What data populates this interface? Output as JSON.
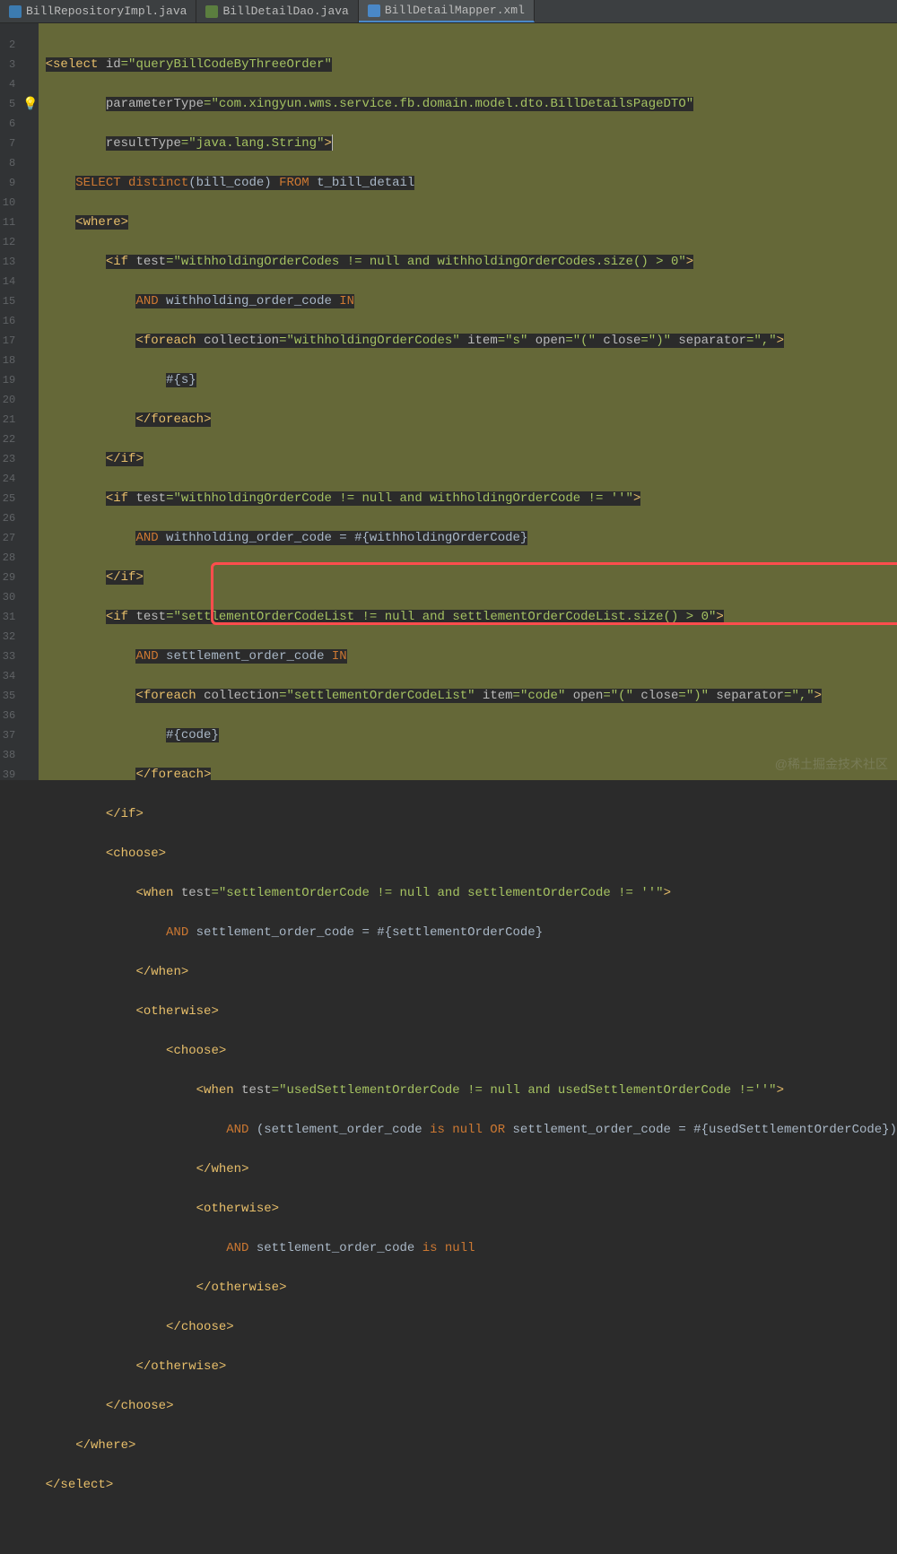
{
  "tabs": [
    {
      "label": "BillRepositoryImpl.java"
    },
    {
      "label": "BillDetailDao.java"
    },
    {
      "label": "BillDetailMapper.xml"
    }
  ],
  "gutter": {
    "start": 2
  },
  "code": {
    "l1a": "<",
    "l1b": "select ",
    "l1c": "id",
    "l1d": "=",
    "l1e": "\"queryBillCodeByThreeOrder\"",
    "l2a": "parameterType",
    "l2b": "=",
    "l2c": "\"com.xingyun.wms.service.fb.domain.model.dto.BillDetailsPageDTO\"",
    "l3a": "resultType",
    "l3b": "=",
    "l3c": "\"java.lang.String\"",
    "l3d": ">",
    "l4a": "SELECT ",
    "l4b": "distinct",
    "l4c": "(",
    "l4d": "bill_code",
    "l4e": ") ",
    "l4f": "FROM ",
    "l4g": "t_bill_detail",
    "l5a": "<",
    "l5b": "where",
    "l5c": ">",
    "l6a": "<",
    "l6b": "if ",
    "l6c": "test",
    "l6d": "=",
    "l6e": "\"withholdingOrderCodes != null and withholdingOrderCodes.size() > 0\"",
    "l6f": ">",
    "l7a": "AND ",
    "l7b": "withholding_order_code ",
    "l7c": "IN",
    "l8a": "<",
    "l8b": "foreach ",
    "l8c": "collection",
    "l8d": "=",
    "l8e": "\"withholdingOrderCodes\" ",
    "l8f": "item",
    "l8g": "=",
    "l8h": "\"s\" ",
    "l8i": "open",
    "l8j": "=",
    "l8k": "\"(\" ",
    "l8l": "close",
    "l8m": "=",
    "l8n": "\")\" ",
    "l8o": "separator",
    "l8p": "=",
    "l8q": "\",\"",
    "l8r": ">",
    "l9a": "#{s}",
    "l10a": "</",
    "l10b": "foreach",
    "l10c": ">",
    "l11a": "</",
    "l11b": "if",
    "l11c": ">",
    "l12a": "<",
    "l12b": "if ",
    "l12c": "test",
    "l12d": "=",
    "l12e": "\"withholdingOrderCode != null and withholdingOrderCode != ''\"",
    "l12f": ">",
    "l13a": "AND ",
    "l13b": "withholding_order_code = #{withholdingOrderCode}",
    "l14a": "</",
    "l14b": "if",
    "l14c": ">",
    "l15a": "<",
    "l15b": "if ",
    "l15c": "test",
    "l15d": "=",
    "l15e": "\"settlementOrderCodeList != null and settlementOrderCodeList.size() > 0\"",
    "l15f": ">",
    "l16a": "AND ",
    "l16b": "settlement_order_code ",
    "l16c": "IN",
    "l17a": "<",
    "l17b": "foreach ",
    "l17c": "collection",
    "l17d": "=",
    "l17e": "\"settlementOrderCodeList\" ",
    "l17f": "item",
    "l17g": "=",
    "l17h": "\"code\" ",
    "l17i": "open",
    "l17j": "=",
    "l17k": "\"(\" ",
    "l17l": "close",
    "l17m": "=",
    "l17n": "\")\" ",
    "l17o": "separator",
    "l17p": "=",
    "l17q": "\",\"",
    "l17r": ">",
    "l18a": "#{code}",
    "l19a": "</",
    "l19b": "foreach",
    "l19c": ">",
    "l20a": "</",
    "l20b": "if",
    "l20c": ">",
    "l21a": "<",
    "l21b": "choose",
    "l21c": ">",
    "l22a": "<",
    "l22b": "when ",
    "l22c": "test",
    "l22d": "=",
    "l22e": "\"settlementOrderCode != null and settlementOrderCode != ''\"",
    "l22f": ">",
    "l23a": "AND ",
    "l23b": "settlement_order_code = #{settlementOrderCode}",
    "l24a": "</",
    "l24b": "when",
    "l24c": ">",
    "l25a": "<",
    "l25b": "otherwise",
    "l25c": ">",
    "l26a": "<",
    "l26b": "choose",
    "l26c": ">",
    "l27a": "<",
    "l27b": "when ",
    "l27c": "test",
    "l27d": "=",
    "l27e": "\"usedSettlementOrderCode != null and usedSettlementOrderCode !=''\"",
    "l27f": ">",
    "l28a": "AND ",
    "l28b": "(settlement_order_code ",
    "l28c": "is null OR ",
    "l28d": "settlement_order_code = #{usedSettlementOrderCode})",
    "l29a": "</",
    "l29b": "when",
    "l29c": ">",
    "l30a": "<",
    "l30b": "otherwise",
    "l30c": ">",
    "l31a": "AND ",
    "l31b": "settlement_order_code ",
    "l31c": "is null",
    "l32a": "</",
    "l32b": "otherwise",
    "l32c": ">",
    "l33a": "</",
    "l33b": "choose",
    "l33c": ">",
    "l34a": "</",
    "l34b": "otherwise",
    "l34c": ">",
    "l35a": "</",
    "l35b": "choose",
    "l35c": ">",
    "l36a": "</",
    "l36b": "where",
    "l36c": ">",
    "l37a": "</",
    "l37b": "select",
    "l37c": ">"
  },
  "watermark": "@稀土掘金技术社区"
}
